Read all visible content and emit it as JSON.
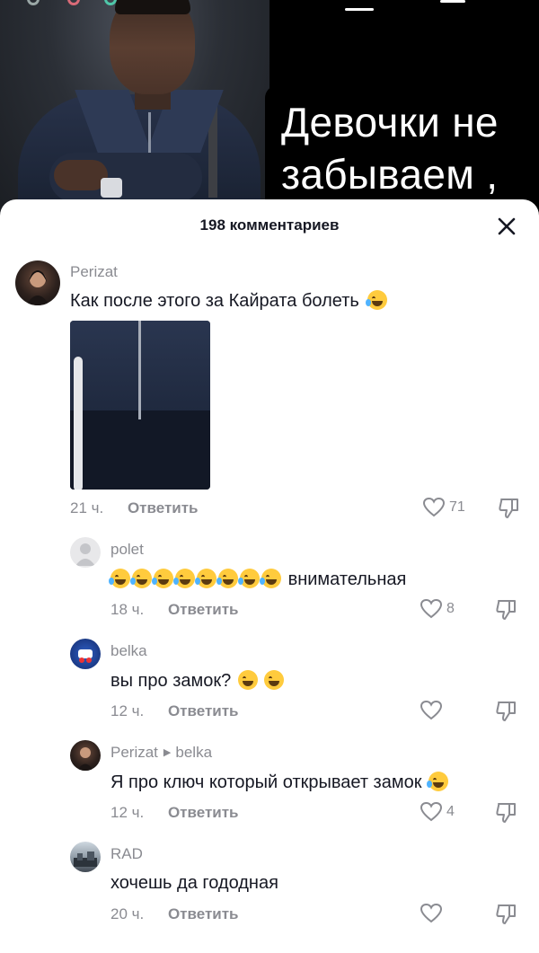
{
  "video": {
    "caption": "Девочки не\nзабываем ,"
  },
  "comments_sheet": {
    "title": "198 комментариев",
    "comments": [
      {
        "user": "Perizat",
        "text": "Как после этого за Кайрата болеть",
        "emoji": [
          "face-with-tears-of-joy"
        ],
        "time": "21 ч.",
        "reply_label": "Ответить",
        "likes": "71"
      },
      {
        "user": "polet",
        "text": "внимательная",
        "emoji_prefix_count": 8,
        "time": "18 ч.",
        "reply_label": "Ответить",
        "likes": "8"
      },
      {
        "user": "belka",
        "text": "вы про замок?",
        "emoji": [
          "face-with-raised-eyebrow",
          "grinning-face"
        ],
        "time": "12 ч.",
        "reply_label": "Ответить",
        "likes": ""
      },
      {
        "user": "Perizat",
        "reply_to": "belka",
        "text": "Я про ключ который открывает замок",
        "emoji": [
          "rolling-on-floor-laughing"
        ],
        "time": "12 ч.",
        "reply_label": "Ответить",
        "likes": "4"
      },
      {
        "user": "RAD",
        "text": "хочешь да гододная",
        "time": "20 ч.",
        "reply_label": "Ответить",
        "likes": ""
      }
    ]
  },
  "colors": {
    "sheet_bg": "#ffffff",
    "text_primary": "#161823",
    "text_secondary": "#8a8b91",
    "caption_text": "#ffffff"
  },
  "icons": {
    "close": "close-icon",
    "like": "heart-outline-icon",
    "dislike": "thumbs-down-icon"
  }
}
